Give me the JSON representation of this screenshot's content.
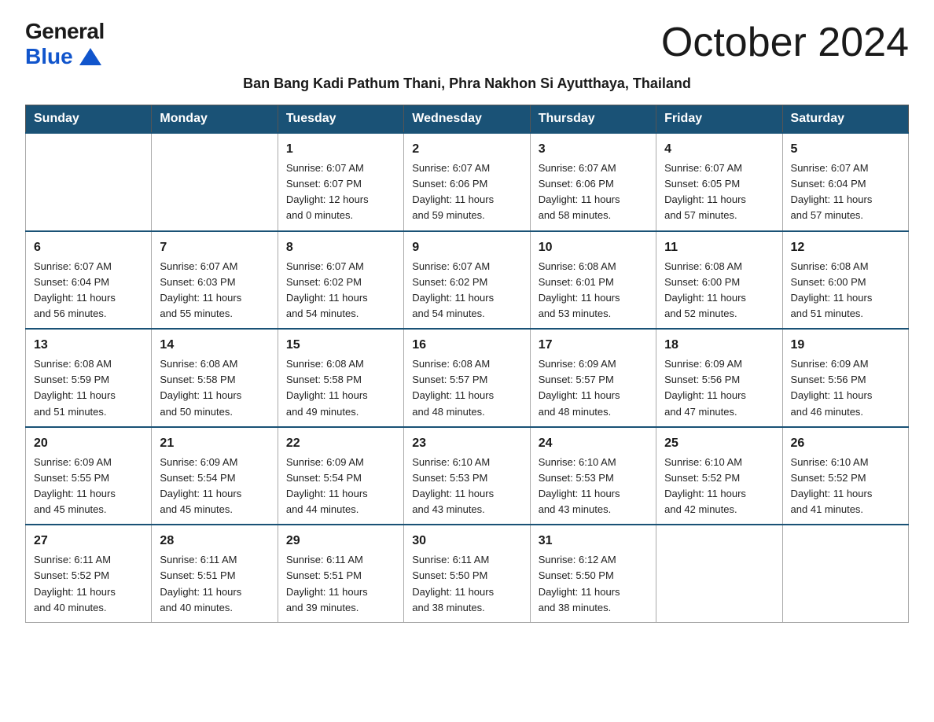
{
  "logo": {
    "general": "General",
    "blue": "Blue"
  },
  "month_title": "October 2024",
  "subtitle": "Ban Bang Kadi Pathum Thani, Phra Nakhon Si Ayutthaya, Thailand",
  "days_of_week": [
    "Sunday",
    "Monday",
    "Tuesday",
    "Wednesday",
    "Thursday",
    "Friday",
    "Saturday"
  ],
  "weeks": [
    [
      {
        "day": "",
        "info": ""
      },
      {
        "day": "",
        "info": ""
      },
      {
        "day": "1",
        "info": "Sunrise: 6:07 AM\nSunset: 6:07 PM\nDaylight: 12 hours\nand 0 minutes."
      },
      {
        "day": "2",
        "info": "Sunrise: 6:07 AM\nSunset: 6:06 PM\nDaylight: 11 hours\nand 59 minutes."
      },
      {
        "day": "3",
        "info": "Sunrise: 6:07 AM\nSunset: 6:06 PM\nDaylight: 11 hours\nand 58 minutes."
      },
      {
        "day": "4",
        "info": "Sunrise: 6:07 AM\nSunset: 6:05 PM\nDaylight: 11 hours\nand 57 minutes."
      },
      {
        "day": "5",
        "info": "Sunrise: 6:07 AM\nSunset: 6:04 PM\nDaylight: 11 hours\nand 57 minutes."
      }
    ],
    [
      {
        "day": "6",
        "info": "Sunrise: 6:07 AM\nSunset: 6:04 PM\nDaylight: 11 hours\nand 56 minutes."
      },
      {
        "day": "7",
        "info": "Sunrise: 6:07 AM\nSunset: 6:03 PM\nDaylight: 11 hours\nand 55 minutes."
      },
      {
        "day": "8",
        "info": "Sunrise: 6:07 AM\nSunset: 6:02 PM\nDaylight: 11 hours\nand 54 minutes."
      },
      {
        "day": "9",
        "info": "Sunrise: 6:07 AM\nSunset: 6:02 PM\nDaylight: 11 hours\nand 54 minutes."
      },
      {
        "day": "10",
        "info": "Sunrise: 6:08 AM\nSunset: 6:01 PM\nDaylight: 11 hours\nand 53 minutes."
      },
      {
        "day": "11",
        "info": "Sunrise: 6:08 AM\nSunset: 6:00 PM\nDaylight: 11 hours\nand 52 minutes."
      },
      {
        "day": "12",
        "info": "Sunrise: 6:08 AM\nSunset: 6:00 PM\nDaylight: 11 hours\nand 51 minutes."
      }
    ],
    [
      {
        "day": "13",
        "info": "Sunrise: 6:08 AM\nSunset: 5:59 PM\nDaylight: 11 hours\nand 51 minutes."
      },
      {
        "day": "14",
        "info": "Sunrise: 6:08 AM\nSunset: 5:58 PM\nDaylight: 11 hours\nand 50 minutes."
      },
      {
        "day": "15",
        "info": "Sunrise: 6:08 AM\nSunset: 5:58 PM\nDaylight: 11 hours\nand 49 minutes."
      },
      {
        "day": "16",
        "info": "Sunrise: 6:08 AM\nSunset: 5:57 PM\nDaylight: 11 hours\nand 48 minutes."
      },
      {
        "day": "17",
        "info": "Sunrise: 6:09 AM\nSunset: 5:57 PM\nDaylight: 11 hours\nand 48 minutes."
      },
      {
        "day": "18",
        "info": "Sunrise: 6:09 AM\nSunset: 5:56 PM\nDaylight: 11 hours\nand 47 minutes."
      },
      {
        "day": "19",
        "info": "Sunrise: 6:09 AM\nSunset: 5:56 PM\nDaylight: 11 hours\nand 46 minutes."
      }
    ],
    [
      {
        "day": "20",
        "info": "Sunrise: 6:09 AM\nSunset: 5:55 PM\nDaylight: 11 hours\nand 45 minutes."
      },
      {
        "day": "21",
        "info": "Sunrise: 6:09 AM\nSunset: 5:54 PM\nDaylight: 11 hours\nand 45 minutes."
      },
      {
        "day": "22",
        "info": "Sunrise: 6:09 AM\nSunset: 5:54 PM\nDaylight: 11 hours\nand 44 minutes."
      },
      {
        "day": "23",
        "info": "Sunrise: 6:10 AM\nSunset: 5:53 PM\nDaylight: 11 hours\nand 43 minutes."
      },
      {
        "day": "24",
        "info": "Sunrise: 6:10 AM\nSunset: 5:53 PM\nDaylight: 11 hours\nand 43 minutes."
      },
      {
        "day": "25",
        "info": "Sunrise: 6:10 AM\nSunset: 5:52 PM\nDaylight: 11 hours\nand 42 minutes."
      },
      {
        "day": "26",
        "info": "Sunrise: 6:10 AM\nSunset: 5:52 PM\nDaylight: 11 hours\nand 41 minutes."
      }
    ],
    [
      {
        "day": "27",
        "info": "Sunrise: 6:11 AM\nSunset: 5:52 PM\nDaylight: 11 hours\nand 40 minutes."
      },
      {
        "day": "28",
        "info": "Sunrise: 6:11 AM\nSunset: 5:51 PM\nDaylight: 11 hours\nand 40 minutes."
      },
      {
        "day": "29",
        "info": "Sunrise: 6:11 AM\nSunset: 5:51 PM\nDaylight: 11 hours\nand 39 minutes."
      },
      {
        "day": "30",
        "info": "Sunrise: 6:11 AM\nSunset: 5:50 PM\nDaylight: 11 hours\nand 38 minutes."
      },
      {
        "day": "31",
        "info": "Sunrise: 6:12 AM\nSunset: 5:50 PM\nDaylight: 11 hours\nand 38 minutes."
      },
      {
        "day": "",
        "info": ""
      },
      {
        "day": "",
        "info": ""
      }
    ]
  ]
}
